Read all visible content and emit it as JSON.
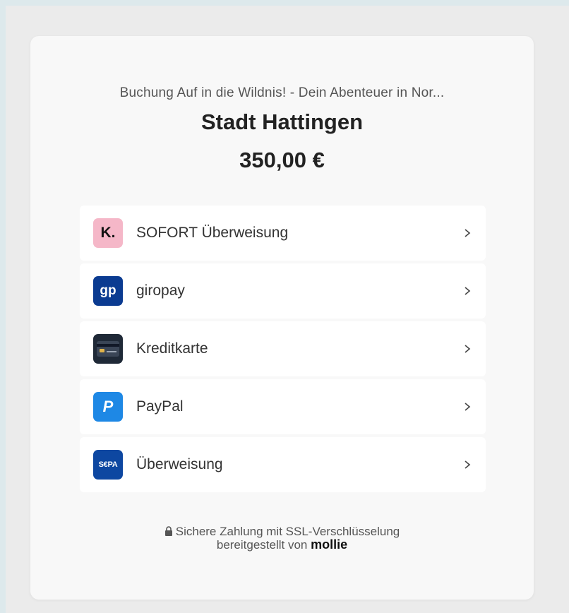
{
  "checkout": {
    "order_description": "Buchung Auf in die Wildnis! - Dein Abenteuer in Nor...",
    "merchant": "Stadt Hattingen",
    "amount": "350,00 €"
  },
  "payment_methods": [
    {
      "label": "SOFORT Überweisung",
      "icon": "klarna-sofort-icon",
      "icon_text": "K.",
      "color": "#f5b7c8"
    },
    {
      "label": "giropay",
      "icon": "giropay-icon",
      "icon_text": "gp",
      "color": "#0b3b91"
    },
    {
      "label": "Kreditkarte",
      "icon": "credit-card-icon",
      "color": "#1f2937"
    },
    {
      "label": "PayPal",
      "icon": "paypal-icon",
      "icon_text": "P",
      "color": "#1e88e5"
    },
    {
      "label": "Überweisung",
      "icon": "sepa-icon",
      "icon_text": "S€PA",
      "color": "#0d47a1"
    }
  ],
  "footer": {
    "security_text": "Sichere Zahlung mit SSL-Verschlüsselung",
    "provided_by": "bereitgestellt von",
    "brand": "mollie"
  }
}
